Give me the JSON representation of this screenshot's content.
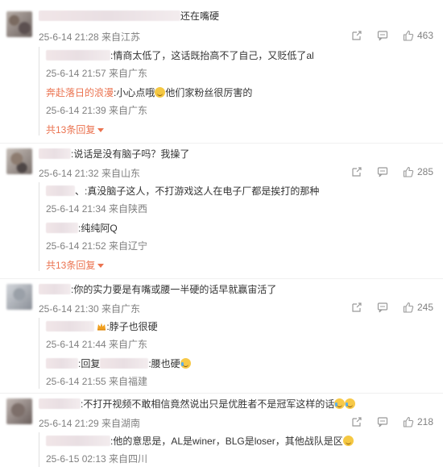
{
  "comments": [
    {
      "text_suffix": "还在嘴硬",
      "meta": "25-6-14 21:28 来自江苏",
      "likes": "463",
      "replies": [
        {
          "text": ":情商太低了，这话既抬高不了自己，又贬低了al",
          "meta": "25-6-14 21:57 来自广东"
        },
        {
          "username": "奔赴落日的浪漫",
          "text": ":小心点哦",
          "text_after": "他们家粉丝很厉害的",
          "meta": "25-6-14 21:39 来自广东"
        }
      ],
      "more": "共13条回复"
    },
    {
      "text": ":说话是没有脑子吗？我操了",
      "meta": "25-6-14 21:32 来自山东",
      "likes": "285",
      "replies": [
        {
          "text": "、:真没脑子这人，不打游戏这人在电子厂都是挨打的那种",
          "meta": "25-6-14 21:34 来自陕西"
        },
        {
          "text": ":纯纯阿Q",
          "meta": "25-6-14 21:52 来自辽宁"
        }
      ],
      "more": "共13条回复"
    },
    {
      "text": ":你的实力要是有嘴或腰一半硬的话早就赢宙活了",
      "meta": "25-6-14 21:30 来自广东",
      "likes": "245",
      "replies": [
        {
          "text": ":脖子也很硬",
          "meta": "25-6-14 21:44 来自广东"
        },
        {
          "text_prefix": ":回复",
          "text": ":腰也硬",
          "meta": "25-6-14 21:55 来自福建"
        }
      ]
    },
    {
      "text": ":不打开视频不敢相信竟然说出只是优胜者不是冠军这样的话",
      "meta": "25-6-14 21:29 来自湖南",
      "likes": "218",
      "replies": [
        {
          "text": ":他的意思是，AL是winer，BLG是loser，其他战队是区",
          "meta": "25-6-15 02:13 来自四川"
        }
      ]
    }
  ],
  "icons": {
    "share": "share-icon",
    "comment": "comment-icon",
    "like": "like-icon"
  }
}
